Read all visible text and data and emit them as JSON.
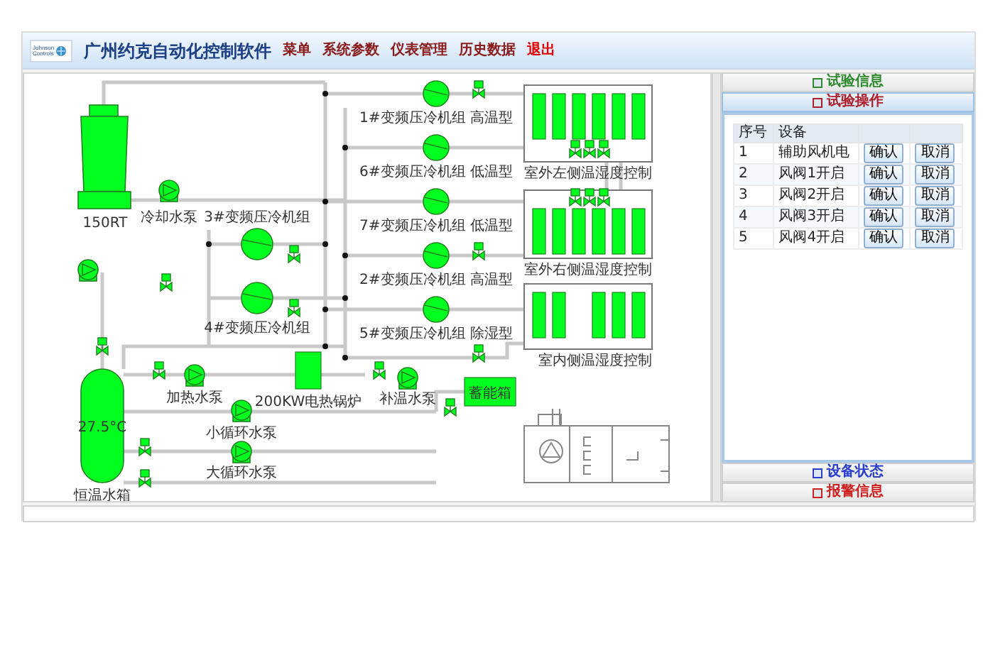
{
  "app": {
    "logo_lines": [
      "Johnson",
      "Controls"
    ],
    "title": "广州约克自动化控制软件",
    "menu": [
      {
        "label": "菜单",
        "color": "#8b1a1a"
      },
      {
        "label": "系统参数",
        "color": "#8b1a1a"
      },
      {
        "label": "仪表管理",
        "color": "#8b1a1a"
      },
      {
        "label": "历史数据",
        "color": "#8b1a1a"
      },
      {
        "label": "退出",
        "color": "#e00000"
      }
    ]
  },
  "diagram": {
    "tower": {
      "label": "150RT"
    },
    "chillers": [
      {
        "label": "1#变频压冷机组 高温型"
      },
      {
        "label": "6#变频压冷机组 低温型"
      },
      {
        "label": "7#变频压冷机组 低温型"
      },
      {
        "label": "2#变频压冷机组 高温型"
      },
      {
        "label": "5#变频压冷机组 除湿型"
      }
    ],
    "left_chillers": [
      {
        "label": "3#变频压冷机组"
      },
      {
        "label": "4#变频压冷机组"
      }
    ],
    "controllers": [
      {
        "label": "室外左侧温湿度控制"
      },
      {
        "label": "室外右侧温湿度控制"
      },
      {
        "label": "室内侧温湿度控制"
      }
    ],
    "pumps": [
      {
        "label": "冷却水泵"
      },
      {
        "label": "加热水泵"
      },
      {
        "label": "小循环水泵"
      },
      {
        "label": "大循环水泵"
      },
      {
        "label": "补温水泵"
      }
    ],
    "tank": {
      "temperature": "27.5°C",
      "label": "恒温水箱"
    },
    "boiler": {
      "label": "200KW电热锅炉"
    },
    "storage": {
      "label": "蓄能箱"
    }
  },
  "side_panel": {
    "sections": [
      {
        "title": "试验信息",
        "color": "#2e8b2e",
        "expanded": false
      },
      {
        "title": "试验操作",
        "color": "#b0202a",
        "expanded": true
      },
      {
        "title": "设备状态",
        "color": "#2a3fd0",
        "expanded": false
      },
      {
        "title": "报警信息",
        "color": "#d02020",
        "expanded": false
      }
    ],
    "table": {
      "columns": [
        "序号",
        "设备"
      ],
      "rows": [
        {
          "cells": [
            "1",
            "辅助风机电"
          ],
          "buttons": [
            "确认",
            "取消"
          ]
        },
        {
          "cells": [
            "2",
            "风阀1开启"
          ],
          "buttons": [
            "确认",
            "取消"
          ]
        },
        {
          "cells": [
            "3",
            "风阀2开启"
          ],
          "buttons": [
            "确认",
            "取消"
          ]
        },
        {
          "cells": [
            "4",
            "风阀3开启"
          ],
          "buttons": [
            "确认",
            "取消"
          ]
        },
        {
          "cells": [
            "5",
            "风阀4开启"
          ],
          "buttons": [
            "确认",
            "取消"
          ]
        }
      ]
    }
  }
}
